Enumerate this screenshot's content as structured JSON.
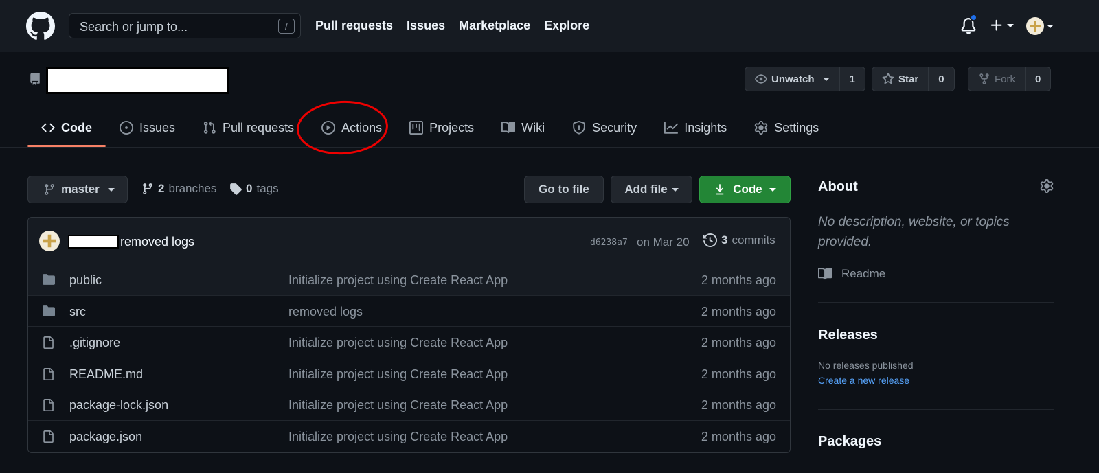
{
  "header": {
    "search_placeholder": "Search or jump to...",
    "search_shortcut": "/",
    "nav": [
      "Pull requests",
      "Issues",
      "Marketplace",
      "Explore"
    ]
  },
  "repo": {
    "watch": {
      "label": "Unwatch",
      "count": "1"
    },
    "star": {
      "label": "Star",
      "count": "0"
    },
    "fork": {
      "label": "Fork",
      "count": "0"
    }
  },
  "tabs": [
    {
      "label": "Code",
      "icon": "code-icon",
      "active": true
    },
    {
      "label": "Issues",
      "icon": "issue-icon"
    },
    {
      "label": "Pull requests",
      "icon": "pull-request-icon"
    },
    {
      "label": "Actions",
      "icon": "play-icon"
    },
    {
      "label": "Projects",
      "icon": "project-icon"
    },
    {
      "label": "Wiki",
      "icon": "book-icon"
    },
    {
      "label": "Security",
      "icon": "shield-icon"
    },
    {
      "label": "Insights",
      "icon": "graph-icon"
    },
    {
      "label": "Settings",
      "icon": "gear-icon"
    }
  ],
  "branch": {
    "name": "master",
    "branches_count": "2",
    "branches_label": "branches",
    "tags_count": "0",
    "tags_label": "tags"
  },
  "buttons": {
    "go_to_file": "Go to file",
    "add_file": "Add file",
    "code": "Code"
  },
  "commit": {
    "message": "removed logs",
    "hash": "d6238a7",
    "date": "on Mar 20",
    "count": "3",
    "count_label": "commits"
  },
  "files": [
    {
      "name": "public",
      "type": "folder",
      "message": "Initialize project using Create React App",
      "age": "2 months ago"
    },
    {
      "name": "src",
      "type": "folder",
      "message": "removed logs",
      "age": "2 months ago"
    },
    {
      "name": ".gitignore",
      "type": "file",
      "message": "Initialize project using Create React App",
      "age": "2 months ago"
    },
    {
      "name": "README.md",
      "type": "file",
      "message": "Initialize project using Create React App",
      "age": "2 months ago"
    },
    {
      "name": "package-lock.json",
      "type": "file",
      "message": "Initialize project using Create React App",
      "age": "2 months ago"
    },
    {
      "name": "package.json",
      "type": "file",
      "message": "Initialize project using Create React App",
      "age": "2 months ago"
    }
  ],
  "sidebar": {
    "about_title": "About",
    "description": "No description, website, or topics provided.",
    "readme": "Readme",
    "releases_title": "Releases",
    "releases_none": "No releases published",
    "create_release": "Create a new release",
    "packages_title": "Packages"
  },
  "colors": {
    "accent_green": "#238636",
    "active_tab_underline": "#f78166",
    "link": "#58a6ff",
    "annotation": "#ee0000"
  }
}
